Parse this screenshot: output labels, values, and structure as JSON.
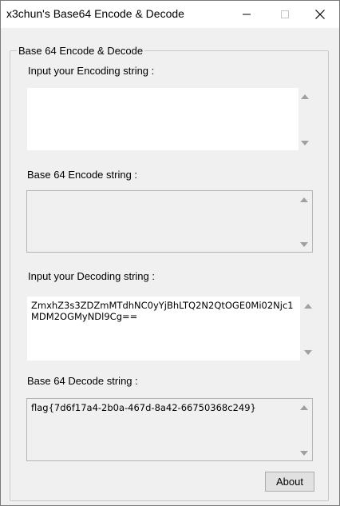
{
  "window": {
    "title": "x3chun's Base64 Encode & Decode"
  },
  "group": {
    "title": "Base 64 Encode & Decode"
  },
  "encode_input": {
    "label": "Input your Encoding string :",
    "value": ""
  },
  "encode_output": {
    "label": "Base 64 Encode string :",
    "value": ""
  },
  "decode_input": {
    "label": "Input your Decoding string :",
    "value": "ZmxhZ3s3ZDZmMTdhNC0yYjBhLTQ2N2QtOGE0Mi02Njc1MDM2OGMyNDl9Cg=="
  },
  "decode_output": {
    "label": "Base 64 Decode string :",
    "value": "flag{7d6f17a4-2b0a-467d-8a42-66750368c249}"
  },
  "buttons": {
    "about": "About"
  },
  "icons": {
    "minimize": "minimize-icon",
    "maximize": "maximize-icon",
    "close": "close-icon",
    "scroll_up": "scroll-up-arrow-icon",
    "scroll_down": "scroll-down-arrow-icon"
  }
}
